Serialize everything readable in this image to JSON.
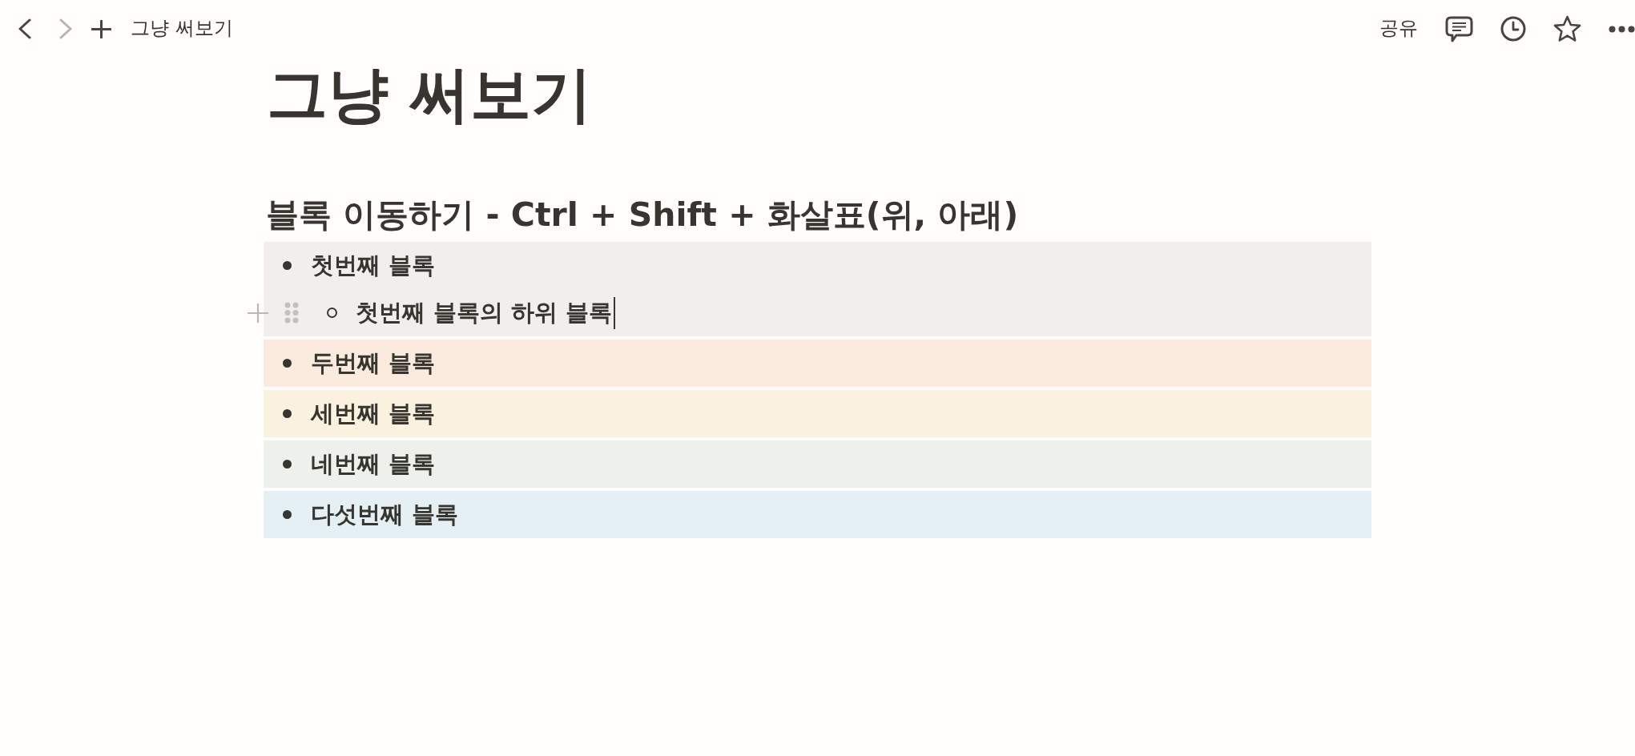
{
  "topbar": {
    "nav": [
      {
        "kind": "back",
        "disabled": false
      },
      {
        "kind": "forward",
        "disabled": true
      }
    ],
    "breadcrumb": "그냥 써보기",
    "share": "공유"
  },
  "page": {
    "title": "그냥 써보기",
    "heading": "블록 이동하기 - Ctrl + Shift + 화살표(위, 아래)"
  },
  "blocks": [
    {
      "text": "첫번째 블록",
      "color": "#f3eeee",
      "focused": false,
      "children": [
        {
          "text": "첫번째 블록의 하위 블록",
          "focused": true
        }
      ]
    },
    {
      "text": "두번째 블록",
      "color": "#fbebdf",
      "focused": false
    },
    {
      "text": "세번째 블록",
      "color": "#faf1de",
      "focused": false
    },
    {
      "text": "네번째 블록",
      "color": "#edf0eb",
      "focused": false
    },
    {
      "text": "다섯번째 블록",
      "color": "#e5f0f4",
      "focused": false
    }
  ]
}
